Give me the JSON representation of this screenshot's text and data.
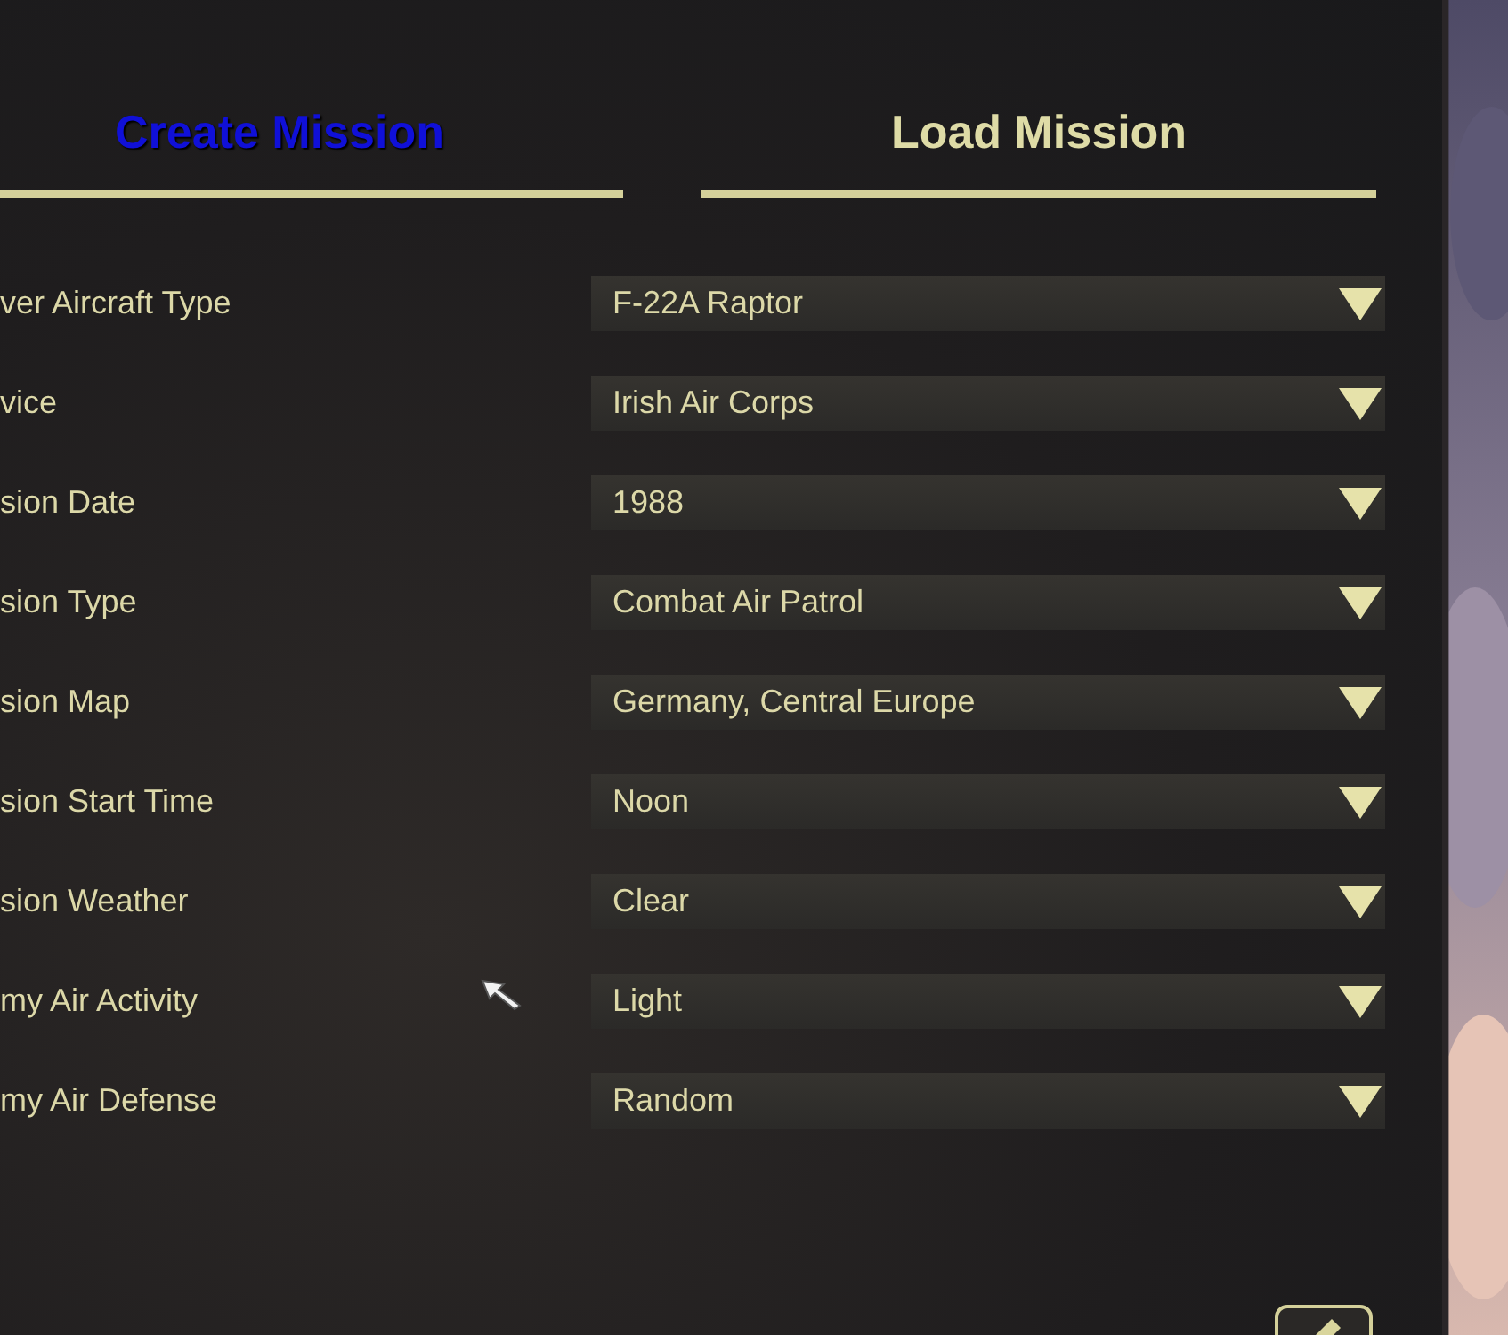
{
  "tabs": [
    {
      "label": "Create Mission",
      "selected": true
    },
    {
      "label": "Load Mission",
      "selected": false
    }
  ],
  "fields": [
    {
      "label": "ver Aircraft Type",
      "value": "F-22A Raptor"
    },
    {
      "label": "vice",
      "value": "Irish Air Corps"
    },
    {
      "label": "sion Date",
      "value": "1988"
    },
    {
      "label": "sion Type",
      "value": "Combat Air Patrol"
    },
    {
      "label": "sion Map",
      "value": "Germany, Central Europe"
    },
    {
      "label": "sion Start Time",
      "value": "Noon"
    },
    {
      "label": "sion Weather",
      "value": "Clear"
    },
    {
      "label": "my Air Activity",
      "value": "Light"
    },
    {
      "label": "my Air Defense",
      "value": "Random"
    }
  ]
}
